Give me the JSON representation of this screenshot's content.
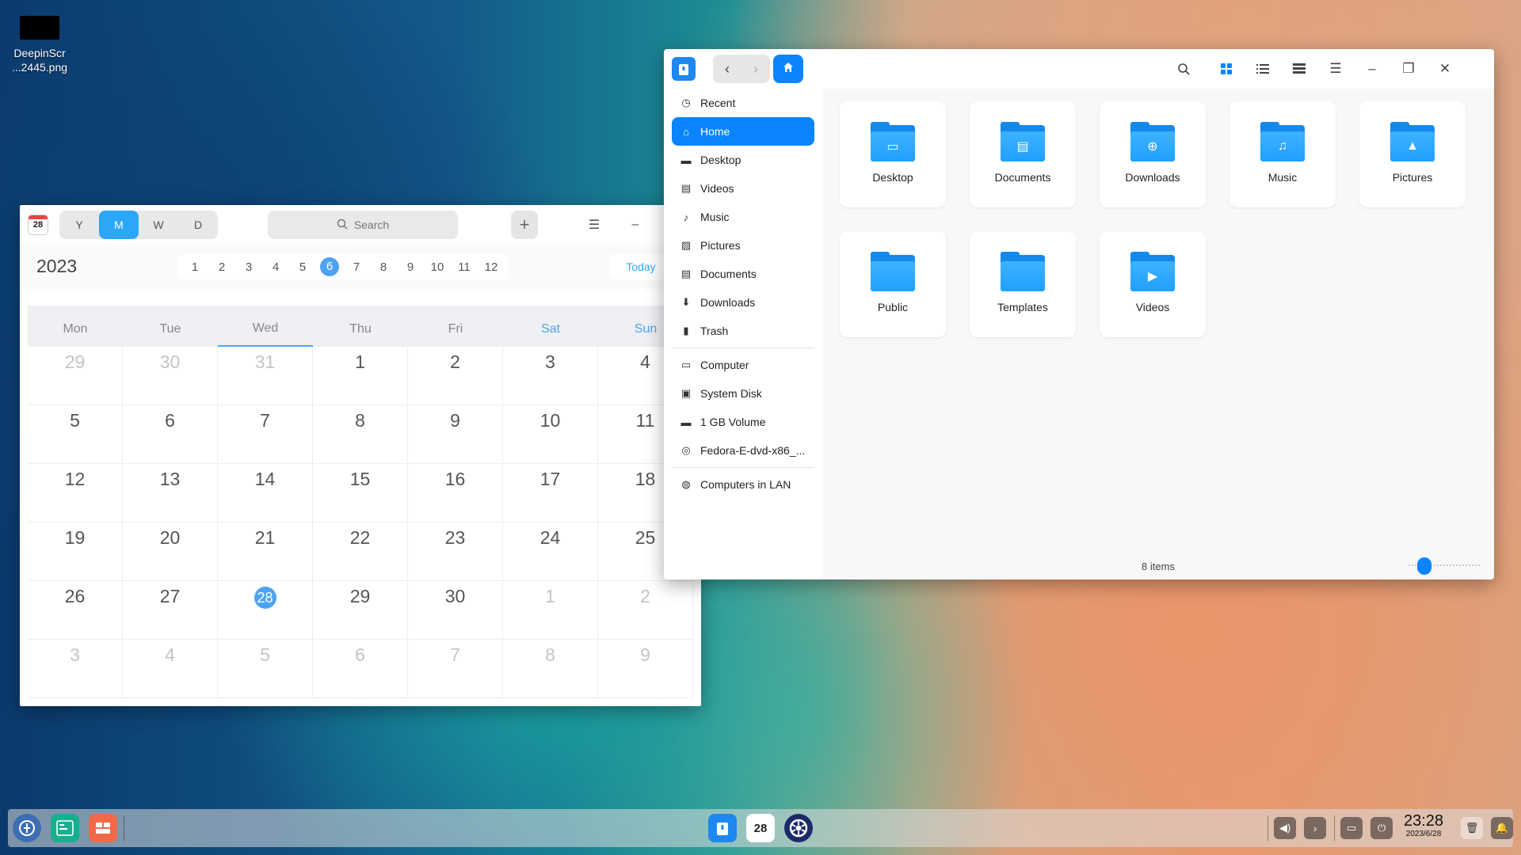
{
  "desktop": {
    "icon_label_line1": "DeepinScr",
    "icon_label_line2": "...2445.png"
  },
  "calendar": {
    "app_icon_day": "28",
    "views": [
      "Y",
      "M",
      "W",
      "D"
    ],
    "active_view": "M",
    "search_placeholder": "Search",
    "add_icon": "+",
    "year": "2023",
    "months": [
      "1",
      "2",
      "3",
      "4",
      "5",
      "6",
      "7",
      "8",
      "9",
      "10",
      "11",
      "12"
    ],
    "active_month": "6",
    "today_label": "Today",
    "weekdays": [
      "Mon",
      "Tue",
      "Wed",
      "Thu",
      "Fri",
      "Sat",
      "Sun"
    ],
    "weeks": [
      [
        "29",
        "30",
        "31",
        "1",
        "2",
        "3",
        "4"
      ],
      [
        "5",
        "6",
        "7",
        "8",
        "9",
        "10",
        "11"
      ],
      [
        "12",
        "13",
        "14",
        "15",
        "16",
        "17",
        "18"
      ],
      [
        "19",
        "20",
        "21",
        "22",
        "23",
        "24",
        "25"
      ],
      [
        "26",
        "27",
        "28",
        "29",
        "30",
        "1",
        "2"
      ],
      [
        "3",
        "4",
        "5",
        "6",
        "7",
        "8",
        "9"
      ]
    ],
    "today": "28"
  },
  "file_manager": {
    "sidebar": [
      {
        "label": "Recent",
        "icon": "clock-icon",
        "glyph": "◷"
      },
      {
        "label": "Home",
        "icon": "home-icon",
        "glyph": "⌂",
        "active": true
      },
      {
        "label": "Desktop",
        "icon": "desktop-icon",
        "glyph": "▬"
      },
      {
        "label": "Videos",
        "icon": "film-icon",
        "glyph": "▤"
      },
      {
        "label": "Music",
        "icon": "music-icon",
        "glyph": "♪"
      },
      {
        "label": "Pictures",
        "icon": "picture-icon",
        "glyph": "▨"
      },
      {
        "label": "Documents",
        "icon": "document-icon",
        "glyph": "▤"
      },
      {
        "label": "Downloads",
        "icon": "download-icon",
        "glyph": "⬇"
      },
      {
        "label": "Trash",
        "icon": "trash-icon",
        "glyph": "▮"
      },
      {
        "label": "Computer",
        "icon": "computer-icon",
        "glyph": "▭",
        "sep_before": true
      },
      {
        "label": "System Disk",
        "icon": "disk-icon",
        "glyph": "▣"
      },
      {
        "label": "1 GB Volume",
        "icon": "volume-icon",
        "glyph": "▬"
      },
      {
        "label": "Fedora-E-dvd-x86_...",
        "icon": "optical-disc-icon",
        "glyph": "◎"
      },
      {
        "label": "Computers in LAN",
        "icon": "network-icon",
        "glyph": "◍",
        "sep_before": true
      }
    ],
    "folders": [
      {
        "label": "Desktop",
        "icon": "desktop-folder-icon",
        "glyph": "▭"
      },
      {
        "label": "Documents",
        "icon": "documents-folder-icon",
        "glyph": "▤"
      },
      {
        "label": "Downloads",
        "icon": "downloads-folder-icon",
        "glyph": "⊕"
      },
      {
        "label": "Music",
        "icon": "music-folder-icon",
        "glyph": "♫"
      },
      {
        "label": "Pictures",
        "icon": "pictures-folder-icon",
        "glyph": "▲"
      },
      {
        "label": "Public",
        "icon": "public-folder-icon",
        "glyph": ""
      },
      {
        "label": "Templates",
        "icon": "templates-folder-icon",
        "glyph": ""
      },
      {
        "label": "Videos",
        "icon": "videos-folder-icon",
        "glyph": "▶"
      }
    ],
    "status": "8 items",
    "zoom_level": 0.15
  },
  "taskbar": {
    "clock_time": "23:28",
    "clock_date": "2023/6/28",
    "calendar_day": "28"
  },
  "colors": {
    "accent": "#0a84ff",
    "calendar_accent": "#4da3f3"
  }
}
